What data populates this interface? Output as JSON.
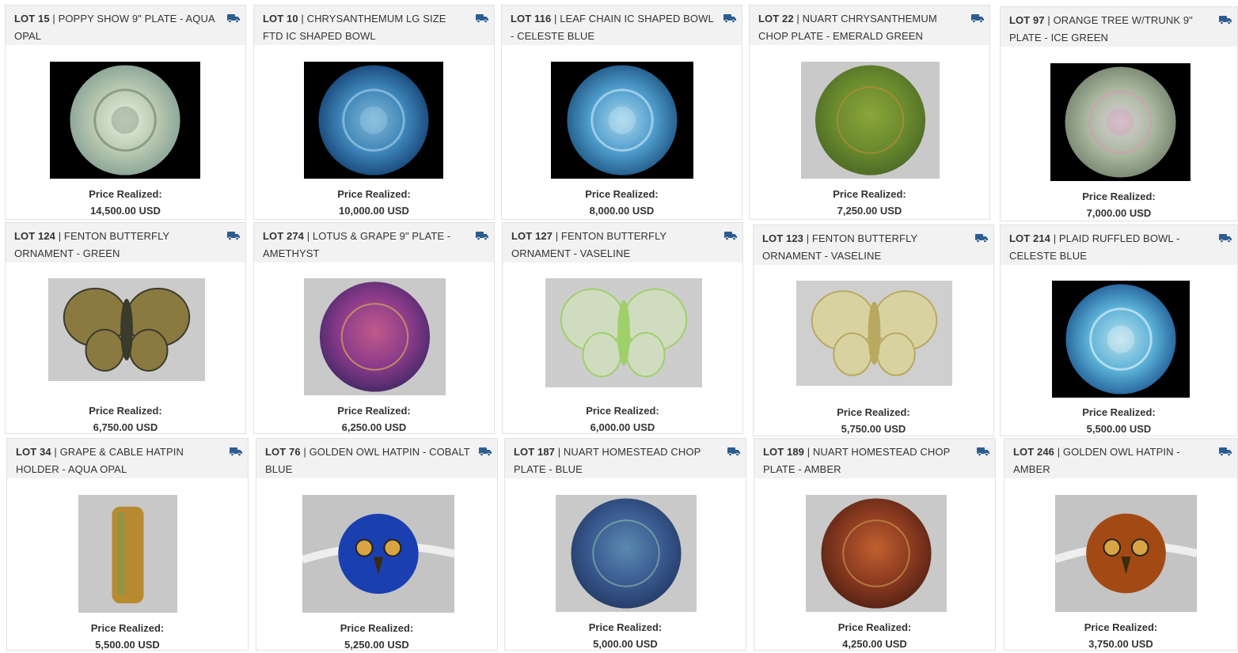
{
  "price_label": "Price Realized:",
  "lots": [
    {
      "lot": "Lot 15",
      "title": "POPPY SHOW 9\" PLATE - AQUA OPAL",
      "price": "14,500.00 USD"
    },
    {
      "lot": "Lot 10",
      "title": "CHRYSANTHEMUM LG SIZE FTD IC SHAPED BOWL",
      "price": "10,000.00 USD"
    },
    {
      "lot": "Lot 116",
      "title": "LEAF CHAIN IC SHAPED BOWL - CELESTE BLUE",
      "price": "8,000.00 USD"
    },
    {
      "lot": "Lot 22",
      "title": "NUART CHRYSANTHEMUM CHOP PLATE - EMERALD GREEN",
      "price": "7,250.00 USD"
    },
    {
      "lot": "Lot 97",
      "title": "ORANGE TREE W/TRUNK 9\" PLATE - ICE GREEN",
      "price": "7,000.00 USD"
    },
    {
      "lot": "Lot 124",
      "title": "FENTON BUTTERFLY ORNAMENT - GREEN",
      "price": "6,750.00 USD"
    },
    {
      "lot": "Lot 274",
      "title": "LOTUS & GRAPE 9\" PLATE - AMETHYST",
      "price": "6,250.00 USD"
    },
    {
      "lot": "Lot 127",
      "title": "FENTON BUTTERFLY ORNAMENT - VASELINE",
      "price": "6,000.00 USD"
    },
    {
      "lot": "Lot 123",
      "title": "FENTON BUTTERFLY ORNAMENT - VASELINE",
      "price": "5,750.00 USD"
    },
    {
      "lot": "Lot 214",
      "title": "PLAID RUFFLED BOWL - CELESTE BLUE",
      "price": "5,500.00 USD"
    },
    {
      "lot": "Lot 34",
      "title": "GRAPE & CABLE HATPIN HOLDER - AQUA OPAL",
      "price": "5,500.00 USD"
    },
    {
      "lot": "Lot 76",
      "title": "GOLDEN OWL HATPIN - COBALT BLUE",
      "price": "5,250.00 USD"
    },
    {
      "lot": "Lot 187",
      "title": "NUART HOMESTEAD CHOP PLATE - BLUE",
      "price": "5,000.00 USD"
    },
    {
      "lot": "Lot 189",
      "title": "NUART HOMESTEAD CHOP PLATE - AMBER",
      "price": "4,250.00 USD"
    },
    {
      "lot": "Lot 246",
      "title": "GOLDEN OWL HATPIN - AMBER",
      "price": "3,750.00 USD"
    }
  ],
  "icons": {
    "shipping": "truck-icon"
  },
  "colors": {
    "header_bg": "#f2f2f2",
    "truck": "#2c5d8f",
    "photo_bg": "#cfcfcf"
  }
}
